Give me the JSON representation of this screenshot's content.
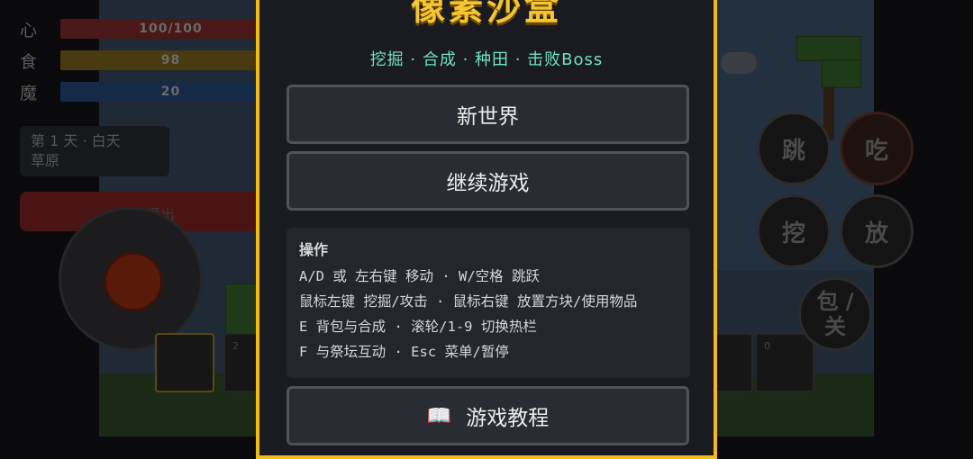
{
  "hud": {
    "stats": [
      {
        "icon": "心",
        "value": "100/100",
        "color": "#4a1818"
      },
      {
        "icon": "食",
        "value": "98",
        "color": "#4a3a10"
      },
      {
        "icon": "魔",
        "value": "20",
        "color": "#152a46"
      }
    ],
    "day_line1": "第 1 天 · 白天",
    "day_line2": "草原",
    "exit_label": "退出"
  },
  "hotbar": [
    "",
    "2",
    "",
    "",
    "",
    "0"
  ],
  "actions": {
    "jump": "跳",
    "eat": "吃",
    "dig": "挖",
    "place": "放",
    "bag": "包 / 关"
  },
  "menu": {
    "title": "像素沙盒",
    "subtitle": "挖掘 · 合成 · 种田 · 击败Boss",
    "new_world": "新世界",
    "continue": "继续游戏",
    "controls": {
      "heading": "操作",
      "lines": [
        "A/D 或 左右键 移动 · W/空格 跳跃",
        "鼠标左键 挖掘/攻击 · 鼠标右键 放置方块/使用物品",
        "E 背包与合成 · 滚轮/1-9 切换热栏",
        "F 与祭坛互动 · Esc 菜单/暂停"
      ]
    },
    "tutorial_icon": "📖",
    "tutorial": "游戏教程"
  },
  "colors": {
    "accent": "#f2b91b",
    "subtitle": "#6fe0c8",
    "panel": "#1a1b20"
  }
}
